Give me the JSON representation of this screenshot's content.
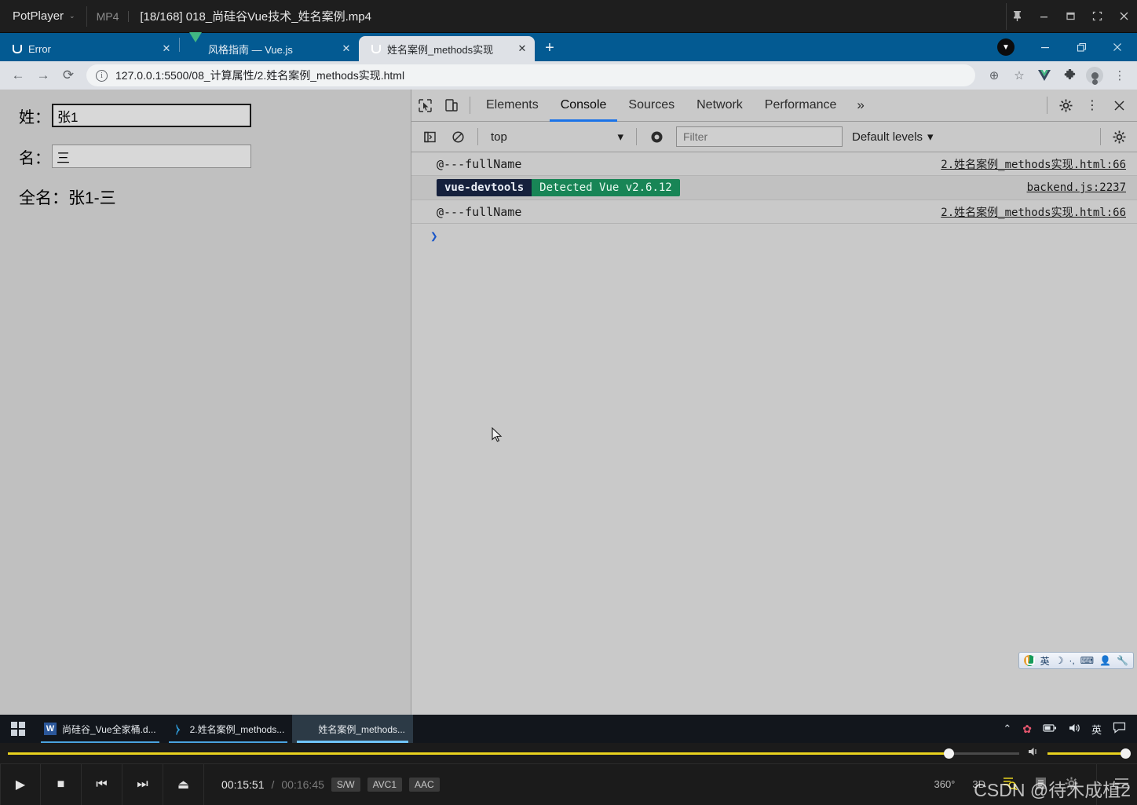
{
  "potplayer": {
    "brand": "PotPlayer",
    "caret": "⌄",
    "filetype": "MP4",
    "filename": "[18/168] 018_尚硅谷Vue技术_姓名案例.mp4",
    "window_buttons": [
      {
        "name": "pin",
        "glyph": "📌"
      },
      {
        "name": "minimize",
        "glyph": "—"
      },
      {
        "name": "maximize",
        "glyph": "▢"
      },
      {
        "name": "fullscreen",
        "glyph": "⛶"
      },
      {
        "name": "close",
        "glyph": "✕"
      }
    ],
    "controls": {
      "play_label": "▶",
      "stop_label": "■",
      "prev_label": "⏮",
      "next_label": "⏭",
      "eject_label": "⏏",
      "current_time": "00:15:51",
      "separator": "/",
      "total_time": "00:16:45",
      "chips": [
        "S/W",
        "AVC1",
        "AAC"
      ],
      "btn_360": "360°",
      "btn_3d": "3D",
      "seek_percent": 93,
      "volume_percent": 100,
      "watermark": "CSDN @待木成植2"
    }
  },
  "chrome": {
    "tabs": [
      {
        "label": "Error",
        "favicon": "u-icon",
        "active": false
      },
      {
        "label": "风格指南 — Vue.js",
        "favicon": "vue-icon",
        "active": false
      },
      {
        "label": "姓名案例_methods实现",
        "favicon": "u-icon",
        "active": true
      }
    ],
    "tab_close_glyph": "✕",
    "new_tab_glyph": "+",
    "window_buttons": [
      {
        "name": "minimize",
        "glyph": "—"
      },
      {
        "name": "restore",
        "glyph": "❐"
      },
      {
        "name": "close",
        "glyph": "✕"
      }
    ],
    "download_badge_glyph": "▼",
    "toolbar": {
      "back_glyph": "←",
      "forward_glyph": "→",
      "reload_glyph": "⟳",
      "info_glyph": "i",
      "url": "127.0.0.1:5500/08_计算属性/2.姓名案例_methods实现.html",
      "zoom_glyph": "⊕",
      "bookmark_glyph": "☆",
      "vue_ext_glyph": "V",
      "extensions_glyph": "🧩",
      "menu_glyph": "⋮"
    }
  },
  "page": {
    "fields": [
      {
        "label": "姓：",
        "value": "张1",
        "focused": true
      },
      {
        "label": "名：",
        "value": "三",
        "focused": false
      }
    ],
    "fullname": "全名：张1-三",
    "ime": {
      "lang": "英",
      "moon": "☽",
      "punct": "·,",
      "keyboard": "⌨",
      "user": "👤",
      "tools": "🔧"
    }
  },
  "devtools": {
    "inspect_glyph": "⬉",
    "device_glyph": "▯",
    "tabs": [
      {
        "label": "Elements",
        "active": false
      },
      {
        "label": "Console",
        "active": true
      },
      {
        "label": "Sources",
        "active": false
      },
      {
        "label": "Network",
        "active": false
      },
      {
        "label": "Performance",
        "active": false
      }
    ],
    "more_glyph": "»",
    "settings_glyph": "⚙",
    "kebab_glyph": "⋮",
    "close_glyph": "✕",
    "console_toolbar": {
      "sidebar_glyph": "▶|",
      "clear_glyph": "🚫",
      "context": "top",
      "context_caret": "▾",
      "eye_glyph": "◉",
      "filter_placeholder": "Filter",
      "levels": "Default levels",
      "levels_caret": "▾",
      "settings_glyph": "⚙"
    },
    "logs": [
      {
        "type": "text",
        "message": "@---fullName",
        "source": "2.姓名案例_methods实现.html:66",
        "highlight": false
      },
      {
        "type": "badge",
        "badge_left": "vue-devtools",
        "badge_right": "Detected Vue v2.6.12",
        "source": "backend.js:2237",
        "highlight": true
      },
      {
        "type": "text",
        "message": "@---fullName",
        "source": "2.姓名案例_methods实现.html:66",
        "highlight": false
      }
    ],
    "prompt_glyph": "❯"
  },
  "taskbar": {
    "start_glyph": "⊞",
    "tasks": [
      {
        "label": "尚硅谷_Vue全家桶.d...",
        "icon": "word-icon",
        "active": false
      },
      {
        "label": "2.姓名案例_methods...",
        "icon": "vscode-icon",
        "active": false
      },
      {
        "label": "姓名案例_methods...",
        "icon": "chrome-icon",
        "active": true
      }
    ],
    "tray": [
      {
        "name": "chevron-up",
        "glyph": "⌃"
      },
      {
        "name": "flower",
        "glyph": "✿"
      },
      {
        "name": "battery",
        "glyph": "🔋"
      },
      {
        "name": "volume",
        "glyph": "🔊"
      },
      {
        "name": "ime-lang",
        "glyph": "英"
      },
      {
        "name": "notifications",
        "glyph": "🗨"
      }
    ]
  },
  "colors": {
    "chrome_blue": "#035a92",
    "devtools_tab_accent": "#1a73e8",
    "badge_left_bg": "#15203c",
    "badge_right_bg": "#188556",
    "potplayer_yellow": "#e8d21e"
  }
}
